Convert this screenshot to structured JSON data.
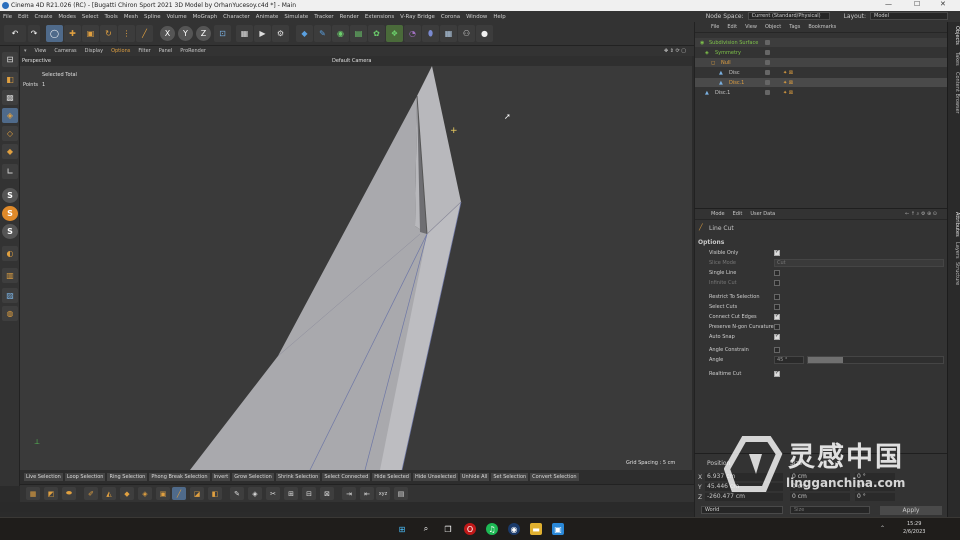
{
  "titlebar": {
    "title": "Cinema 4D R21.026 (RC) - [Bugatti Chiron Sport 2021 3D Model by OrhanYucesoy.c4d *] - Main",
    "min": "—",
    "max": "☐",
    "close": "✕"
  },
  "menu": [
    "File",
    "Edit",
    "Create",
    "Modes",
    "Select",
    "Tools",
    "Mesh",
    "Spline",
    "Volume",
    "MoGraph",
    "Character",
    "Animate",
    "Simulate",
    "Tracker",
    "Render",
    "Extensions",
    "V-Ray Bridge",
    "Corona",
    "Window",
    "Help"
  ],
  "node_space": {
    "label": "Node Space:",
    "value": "Current (Standard/Physical)"
  },
  "layout": {
    "label": "Layout:",
    "value": "Model"
  },
  "viewport_menu": [
    "View",
    "Cameras",
    "Display",
    "Options",
    "Filter",
    "Panel",
    "ProRender"
  ],
  "viewport": {
    "name": "Perspective",
    "camera": "Default Camera",
    "selected_total_label": "Selected Total",
    "points_label": "Points",
    "points_value": "1",
    "grid_spacing": "Grid Spacing : 5 cm"
  },
  "selection_buttons": [
    "Live Selection",
    "Loop Selection",
    "Ring Selection",
    "Phong Break Selection",
    "Invert",
    "Grow Selection",
    "Shrink Selection",
    "Select Connected",
    "Hide Selected",
    "Hide Unselected",
    "Unhide All",
    "Set Selection",
    "Convert Selection"
  ],
  "object_manager": {
    "menu": [
      "File",
      "Edit",
      "View",
      "Object",
      "Tags",
      "Bookmarks"
    ],
    "objects": [
      {
        "name": "Subdivision Surface",
        "color": "#7ec24a"
      },
      {
        "name": "Symmetry",
        "color": "#7ec24a"
      },
      {
        "name": "Null",
        "color": "#e0a040"
      },
      {
        "name": "Disc",
        "color": "#d0d0d0"
      },
      {
        "name": "Disc.1",
        "color": "#e0a040"
      },
      {
        "name": "Disc.1",
        "color": "#d0d0d0"
      }
    ]
  },
  "attribute_manager": {
    "menu": [
      "Mode",
      "Edit",
      "User Data"
    ],
    "tool_name": "Line Cut",
    "section": "Options",
    "options": [
      {
        "label": "Visible Only",
        "checked": true,
        "dim": false
      },
      {
        "label": "Slice Mode",
        "value": "Cut",
        "dim": true
      },
      {
        "label": "Single Line",
        "checked": false,
        "dim": false
      },
      {
        "label": "Infinite Cut",
        "checked": false,
        "dim": true
      },
      {
        "label": "Restrict To Selection",
        "checked": false,
        "dim": false
      },
      {
        "label": "Select Cuts",
        "checked": false,
        "dim": false
      },
      {
        "label": "Connect Cut Edges",
        "checked": true,
        "dim": false
      },
      {
        "label": "Preserve N-gon Curvature",
        "checked": false,
        "dim": false
      },
      {
        "label": "Auto Snap",
        "checked": true,
        "dim": false
      },
      {
        "label": "Angle Constrain",
        "checked": false,
        "dim": false
      },
      {
        "label": "Angle",
        "value": "45 °",
        "dim": false
      },
      {
        "label": "Realtime Cut",
        "checked": true,
        "dim": false
      }
    ]
  },
  "coordinates": {
    "header": "Position",
    "x": "6.937 cm",
    "y": "45.446 cm",
    "z": "-260.477 cm",
    "x_label": "X",
    "y_label": "Y",
    "z_label": "Z",
    "size_label": "Size",
    "s_x": "0 cm",
    "s_y": "0 cm",
    "s_z": "0 cm",
    "rot_h": "0 °",
    "rot_p": "0 °",
    "rot_b": "0 °",
    "mode": "World",
    "apply": "Apply"
  },
  "right_tabs": [
    "Objects",
    "Takes",
    "Content Browser",
    "Attributes",
    "Layers",
    "Structure"
  ],
  "taskbar": {
    "time": "15:29",
    "date": "2/6/2023"
  },
  "watermark": {
    "text": "灵感中国",
    "url": "lingganchina.com"
  }
}
